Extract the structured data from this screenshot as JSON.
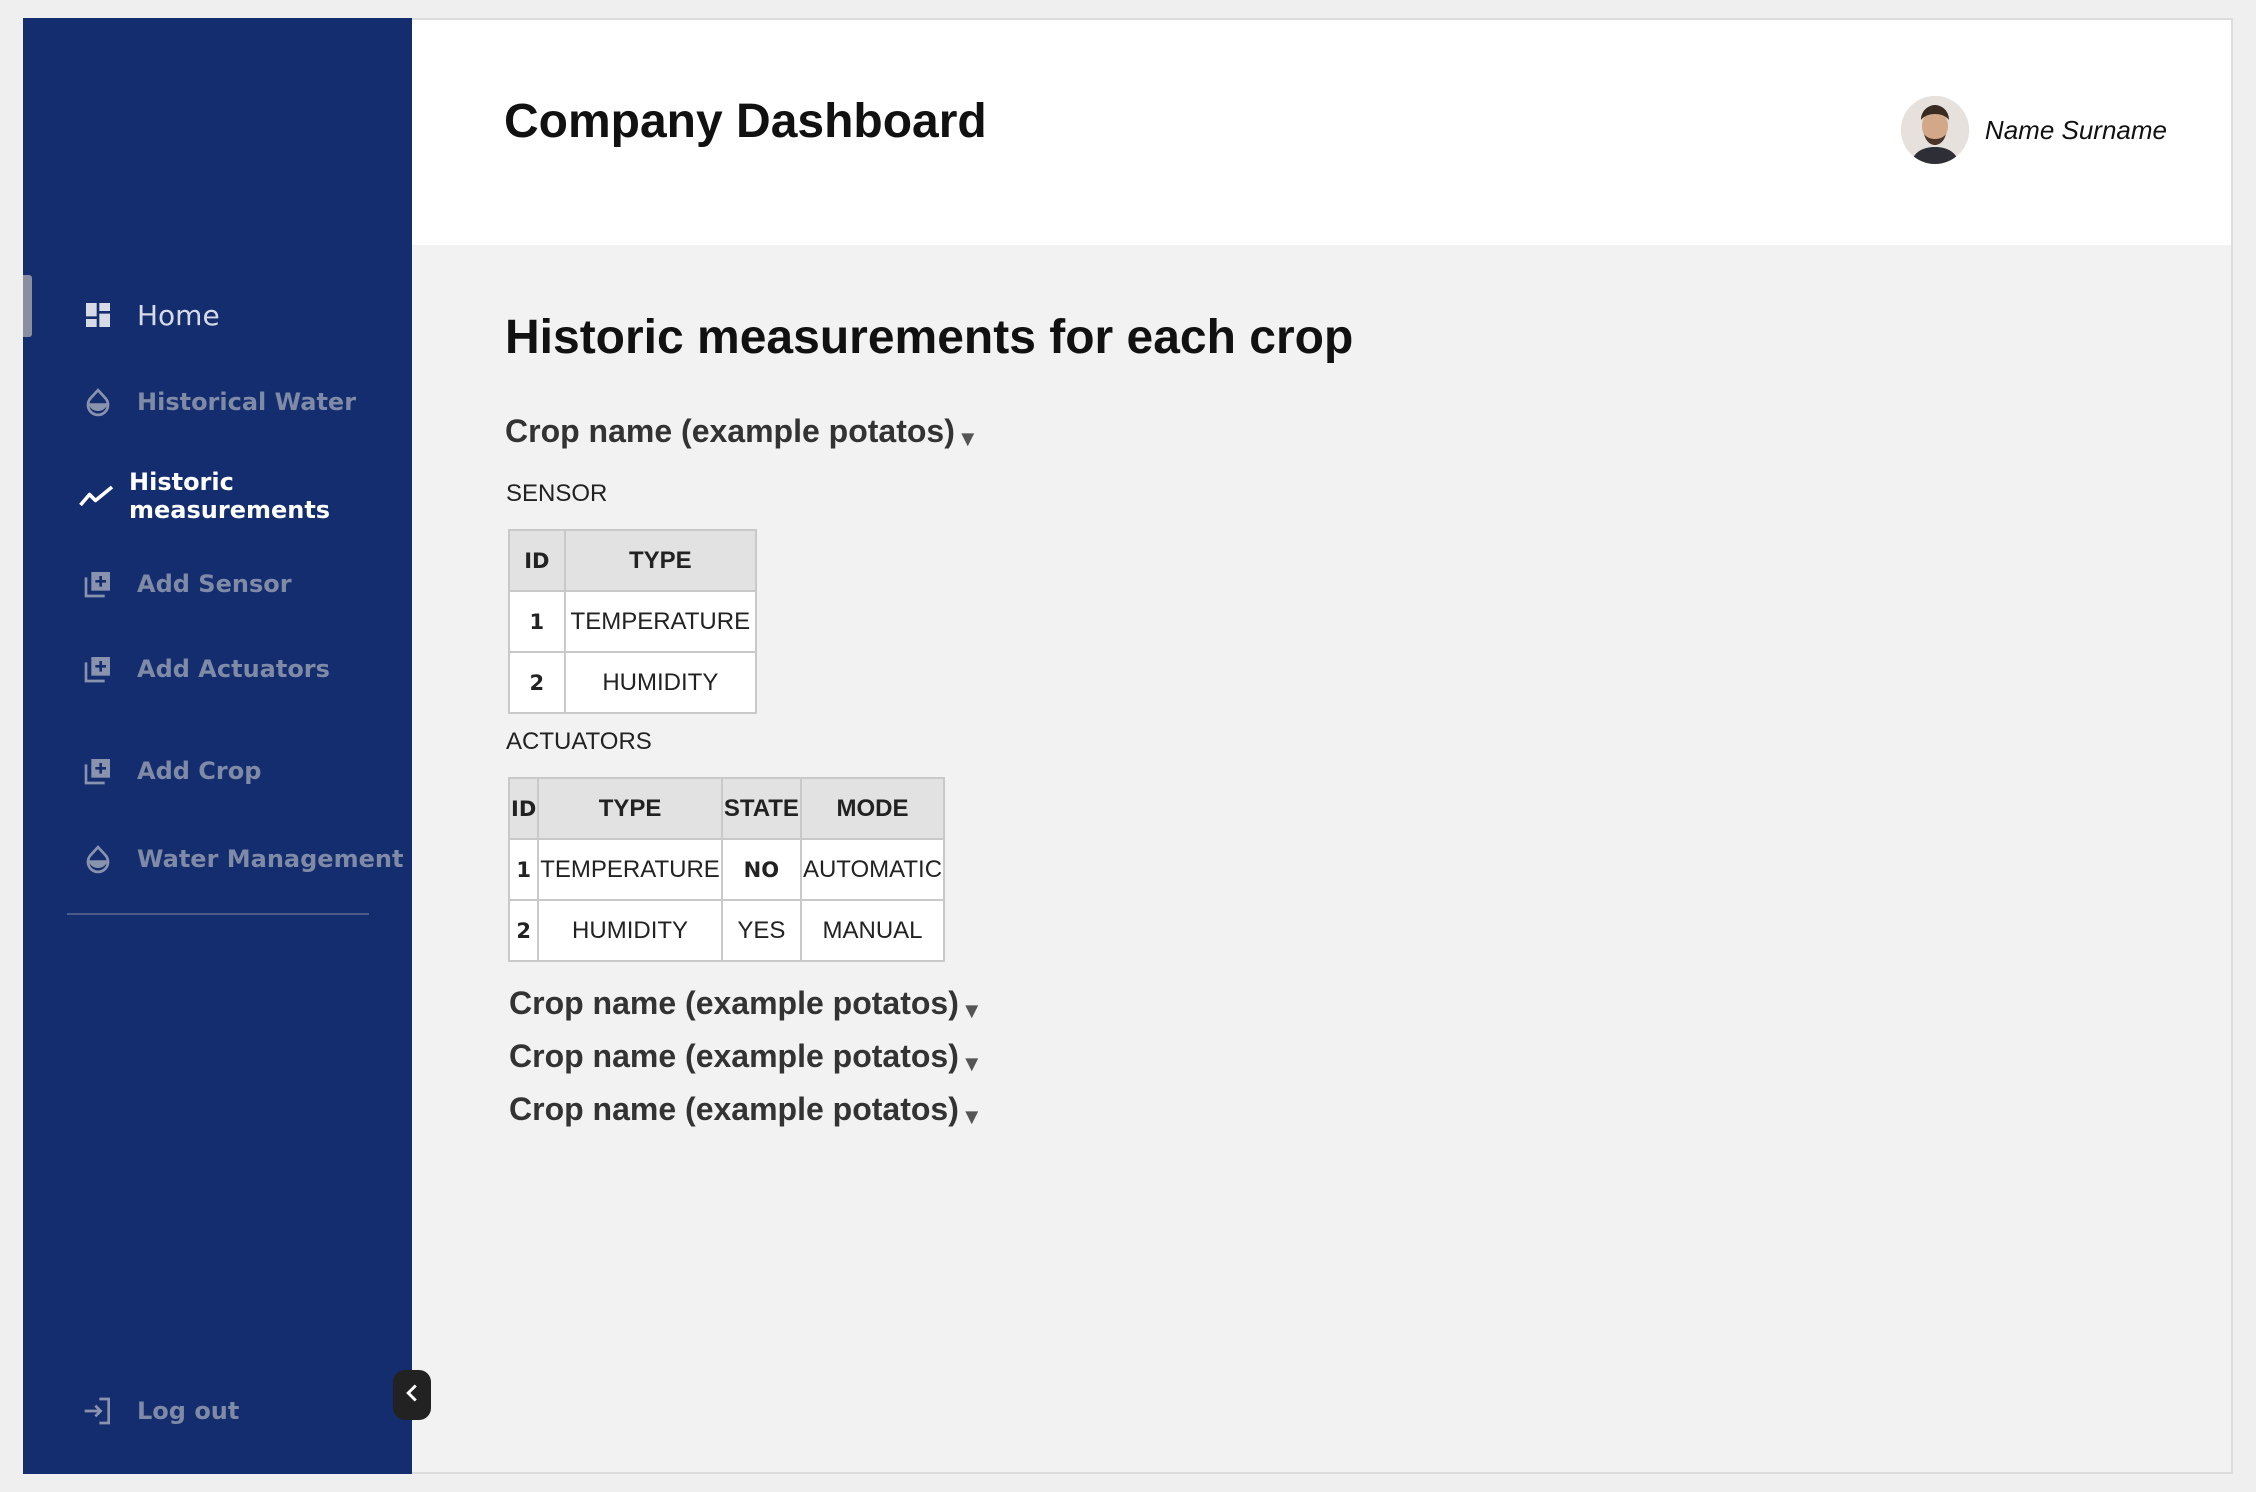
{
  "sidebar": {
    "items": [
      {
        "label": "Home",
        "icon": "dashboard-icon"
      },
      {
        "label": "Historical Water",
        "icon": "water-drop-icon"
      },
      {
        "label": "Historic measurements",
        "icon": "trend-line-icon"
      },
      {
        "label": "Add Sensor",
        "icon": "add-box-icon"
      },
      {
        "label": "Add Actuators",
        "icon": "add-box-icon"
      },
      {
        "label": "Add Crop",
        "icon": "add-box-icon"
      },
      {
        "label": "Water Management",
        "icon": "water-drop-icon"
      }
    ],
    "logout": {
      "label": "Log out",
      "icon": "logout-icon"
    },
    "collapse_icon": "chevron-left-icon",
    "colors": {
      "background": "#142d6e",
      "active_text": "#ffffff",
      "inactive_text": "#7f8aa6"
    }
  },
  "header": {
    "title": "Company Dashboard",
    "user_name": "Name Surname"
  },
  "main": {
    "section_title": "Historic measurements for each crop",
    "crops": [
      {
        "name": "Crop name (example potatos)",
        "expanded": true
      },
      {
        "name": "Crop name (example potatos)",
        "expanded": false
      },
      {
        "name": "Crop name (example potatos)",
        "expanded": false
      },
      {
        "name": "Crop name (example potatos)",
        "expanded": false
      }
    ],
    "sensor": {
      "label": "SENSOR",
      "columns": [
        "ID",
        "TYPE"
      ],
      "rows": [
        [
          "1",
          "TEMPERATURE"
        ],
        [
          "2",
          "HUMIDITY"
        ]
      ]
    },
    "actuators": {
      "label": "ACTUATORS",
      "columns": [
        "ID",
        "TYPE",
        "STATE",
        "MODE"
      ],
      "rows": [
        [
          "1",
          "TEMPERATURE",
          "NO",
          "AUTOMATIC"
        ],
        [
          "2",
          "HUMIDITY",
          "YES",
          "MANUAL"
        ]
      ]
    }
  }
}
